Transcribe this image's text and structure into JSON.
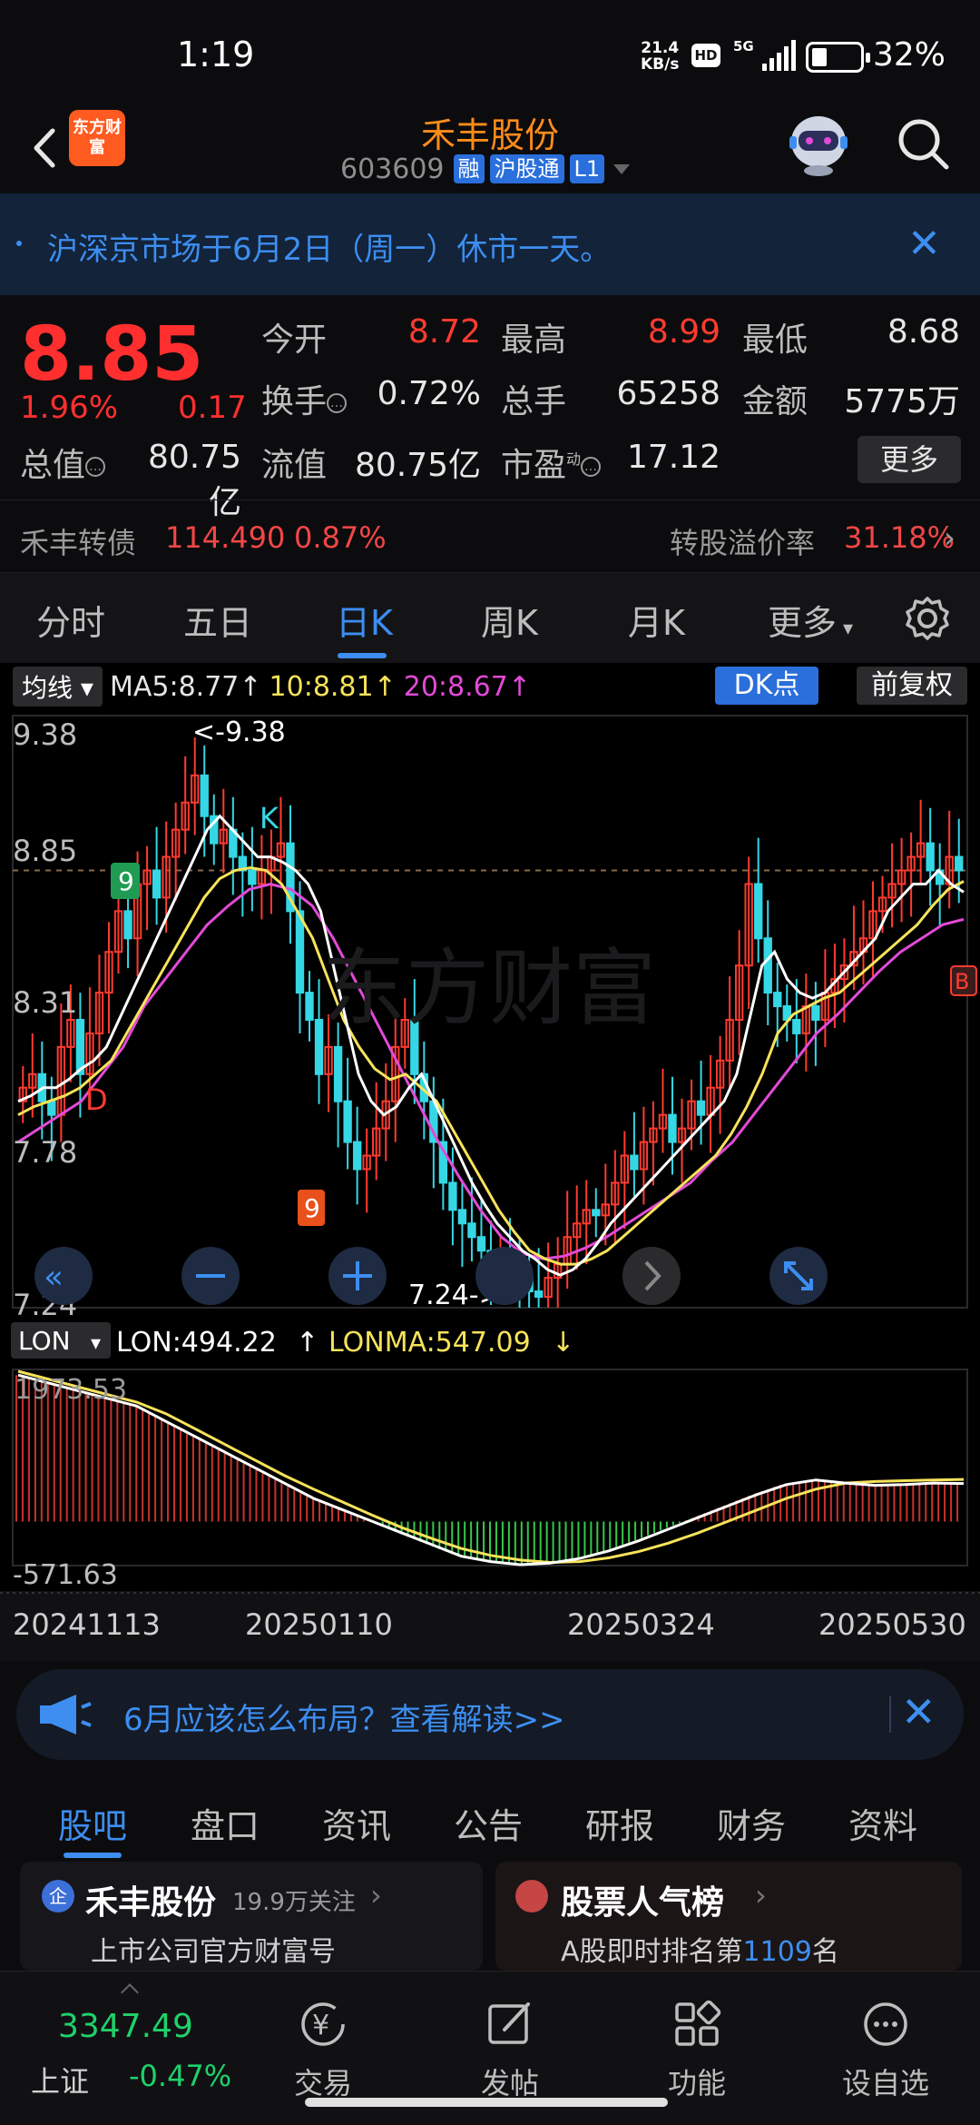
{
  "status_bar": {
    "time": "1:19",
    "net_speed_top": "21.4",
    "net_speed_bottom": "KB/s",
    "hd": "HD",
    "network": "5G",
    "battery": "32%"
  },
  "header": {
    "logo_text": "东方财富",
    "stock_name": "禾丰股份",
    "stock_code": "603609",
    "tags": [
      "融",
      "沪股通",
      "L1"
    ]
  },
  "notice": {
    "text": "沪深京市场于6月2日（周一）休市一天。"
  },
  "quote": {
    "price": "8.85",
    "change_pct": "1.96%",
    "change": "0.17",
    "fields": [
      {
        "label": "今开",
        "value": "8.72",
        "color": "#ff3b30"
      },
      {
        "label": "最高",
        "value": "8.99",
        "color": "#ff3b30"
      },
      {
        "label": "最低",
        "value": "8.68",
        "color": "#e6e6e6"
      },
      {
        "label": "换手",
        "value": "0.72%",
        "color": "#e6e6e6"
      },
      {
        "label": "总手",
        "value": "65258",
        "color": "#e6e6e6"
      },
      {
        "label": "金额",
        "value": "5775万",
        "color": "#e6e6e6"
      },
      {
        "label": "总值",
        "value": "80.75亿",
        "color": "#e6e6e6"
      },
      {
        "label": "流值",
        "value": "80.75亿",
        "color": "#e6e6e6"
      },
      {
        "label": "市盈",
        "value": "17.12",
        "color": "#e6e6e6"
      }
    ],
    "pe_superscript": "动",
    "more": "更多"
  },
  "bond": {
    "name": "禾丰转债",
    "price": "114.490",
    "pct": "0.87%",
    "premium_label": "转股溢价率",
    "premium_value": "31.18%"
  },
  "period_tabs": [
    "分时",
    "五日",
    "日K",
    "周K",
    "月K",
    "更多"
  ],
  "active_period": "日K",
  "chart": {
    "indicator_select": "均线",
    "ma5": "MA5:8.77",
    "ma10": "10:8.81",
    "ma20": "20:8.67",
    "dk_button": "DK点",
    "adjust_button": "前复权",
    "y_labels": [
      "9.38",
      "8.85",
      "8.31",
      "7.78",
      "7.24"
    ],
    "high_annotation": "<-9.38",
    "low_annotation": "7.24->",
    "sub_indicator_select": "LON",
    "lon": "LON:494.22",
    "lonma": "LONMA:547.09",
    "sub_y_top": "1973.53",
    "sub_y_bottom": "-571.63",
    "dates": [
      "20241113",
      "20250110",
      "20250324",
      "20250530"
    ],
    "markers": {
      "K": "K",
      "D": "D",
      "B": "B"
    },
    "nine_labels": [
      "9"
    ]
  },
  "chart_data": {
    "type": "candlestick",
    "title": "",
    "y_range": [
      7.24,
      9.38
    ],
    "sub_range": [
      -571.63,
      1973.53
    ],
    "close": [
      8.05,
      8.1,
      8.0,
      7.95,
      8.2,
      8.3,
      8.1,
      8.25,
      8.4,
      8.55,
      8.7,
      8.6,
      8.8,
      8.85,
      8.75,
      8.9,
      9.0,
      9.1,
      9.2,
      9.05,
      8.95,
      9.0,
      8.9,
      8.85,
      8.8,
      8.85,
      8.9,
      8.95,
      8.7,
      8.4,
      8.3,
      8.1,
      8.2,
      8.0,
      7.85,
      7.75,
      7.8,
      7.9,
      8.0,
      8.2,
      8.3,
      8.1,
      8.0,
      7.85,
      7.7,
      7.6,
      7.55,
      7.5,
      7.45,
      7.4,
      7.42,
      7.38,
      7.35,
      7.3,
      7.28,
      7.35,
      7.4,
      7.5,
      7.55,
      7.6,
      7.58,
      7.62,
      7.7,
      7.8,
      7.75,
      7.85,
      7.9,
      7.95,
      7.85,
      7.9,
      8.0,
      7.95,
      8.05,
      8.15,
      8.3,
      8.5,
      8.8,
      8.6,
      8.4,
      8.35,
      8.3,
      8.25,
      8.35,
      8.3,
      8.4,
      8.45,
      8.5,
      8.55,
      8.6,
      8.7,
      8.75,
      8.8,
      8.85,
      8.9,
      8.95,
      8.85,
      8.8,
      8.9,
      8.85
    ],
    "ma5": [
      8.0,
      8.02,
      8.05,
      8.05,
      8.08,
      8.12,
      8.15,
      8.2,
      8.3,
      8.4,
      8.5,
      8.6,
      8.7,
      8.8,
      8.9,
      9.0,
      9.05,
      9.0,
      8.95,
      8.9,
      8.9,
      8.88,
      8.85,
      8.8,
      8.7,
      8.5,
      8.3,
      8.1,
      8.0,
      7.95,
      7.98,
      8.05,
      8.1,
      8.0,
      7.9,
      7.8,
      7.7,
      7.62,
      7.55,
      7.5,
      7.45,
      7.42,
      7.38,
      7.36,
      7.38,
      7.42,
      7.48,
      7.55,
      7.6,
      7.65,
      7.7,
      7.75,
      7.8,
      7.85,
      7.9,
      7.95,
      8.0,
      8.1,
      8.3,
      8.5,
      8.55,
      8.45,
      8.4,
      8.38,
      8.4,
      8.45,
      8.5,
      8.55,
      8.6,
      8.7,
      8.75,
      8.8,
      8.8,
      8.85,
      8.8,
      8.77
    ],
    "ma10": [
      7.95,
      7.98,
      8.0,
      8.02,
      8.05,
      8.1,
      8.15,
      8.25,
      8.35,
      8.45,
      8.55,
      8.65,
      8.75,
      8.82,
      8.85,
      8.86,
      8.85,
      8.8,
      8.7,
      8.6,
      8.45,
      8.3,
      8.2,
      8.12,
      8.08,
      8.1,
      8.05,
      8.0,
      7.9,
      7.8,
      7.7,
      7.6,
      7.52,
      7.45,
      7.42,
      7.4,
      7.4,
      7.42,
      7.45,
      7.5,
      7.55,
      7.6,
      7.65,
      7.7,
      7.75,
      7.8,
      7.88,
      7.98,
      8.1,
      8.25,
      8.32,
      8.35,
      8.38,
      8.4,
      8.45,
      8.5,
      8.55,
      8.6,
      8.65,
      8.72,
      8.78,
      8.81
    ],
    "ma20": [
      7.85,
      7.9,
      7.95,
      8.0,
      8.1,
      8.2,
      8.35,
      8.45,
      8.55,
      8.65,
      8.72,
      8.78,
      8.8,
      8.78,
      8.72,
      8.6,
      8.45,
      8.3,
      8.15,
      8.0,
      7.85,
      7.72,
      7.6,
      7.5,
      7.44,
      7.42,
      7.43,
      7.46,
      7.5,
      7.55,
      7.6,
      7.65,
      7.7,
      7.78,
      7.85,
      7.95,
      8.05,
      8.15,
      8.25,
      8.32,
      8.4,
      8.48,
      8.55,
      8.6,
      8.65,
      8.67
    ],
    "lon": [
      1900,
      1800,
      1700,
      1600,
      1500,
      1300,
      1100,
      900,
      700,
      500,
      300,
      150,
      0,
      -150,
      -300,
      -450,
      -520,
      -560,
      -540,
      -480,
      -380,
      -250,
      -100,
      50,
      200,
      350,
      480,
      540,
      500,
      470,
      480,
      500,
      494
    ],
    "lonma": [
      1950,
      1850,
      1750,
      1650,
      1550,
      1400,
      1200,
      1000,
      800,
      600,
      420,
      250,
      80,
      -80,
      -220,
      -350,
      -440,
      -500,
      -530,
      -520,
      -470,
      -390,
      -280,
      -150,
      0,
      150,
      300,
      420,
      500,
      520,
      530,
      540,
      547
    ]
  },
  "promo": {
    "text": "6月应该怎么布局？查看解读>>"
  },
  "section_tabs": [
    "股吧",
    "盘口",
    "资讯",
    "公告",
    "研报",
    "财务",
    "资料"
  ],
  "active_section": "股吧",
  "cards": {
    "left_badge": "企",
    "left_title": "禾丰股份",
    "left_follow": "19.9万关注",
    "left_sub": "上市公司官方财富号",
    "right_title": "股票人气榜",
    "right_sub_prefix": "A股即时排名第",
    "right_rank": "1109",
    "right_sub_suffix": "名"
  },
  "footer": {
    "index_value": "3347.49",
    "index_name": "上证",
    "index_pct": "-0.47%",
    "items": [
      "交易",
      "发帖",
      "功能",
      "设自选"
    ],
    "yen": "¥"
  },
  "colors": {
    "up": "#ff3b30",
    "down": "#35d7e5",
    "accent": "#3d8ef0",
    "brand": "#ff5a1f"
  }
}
